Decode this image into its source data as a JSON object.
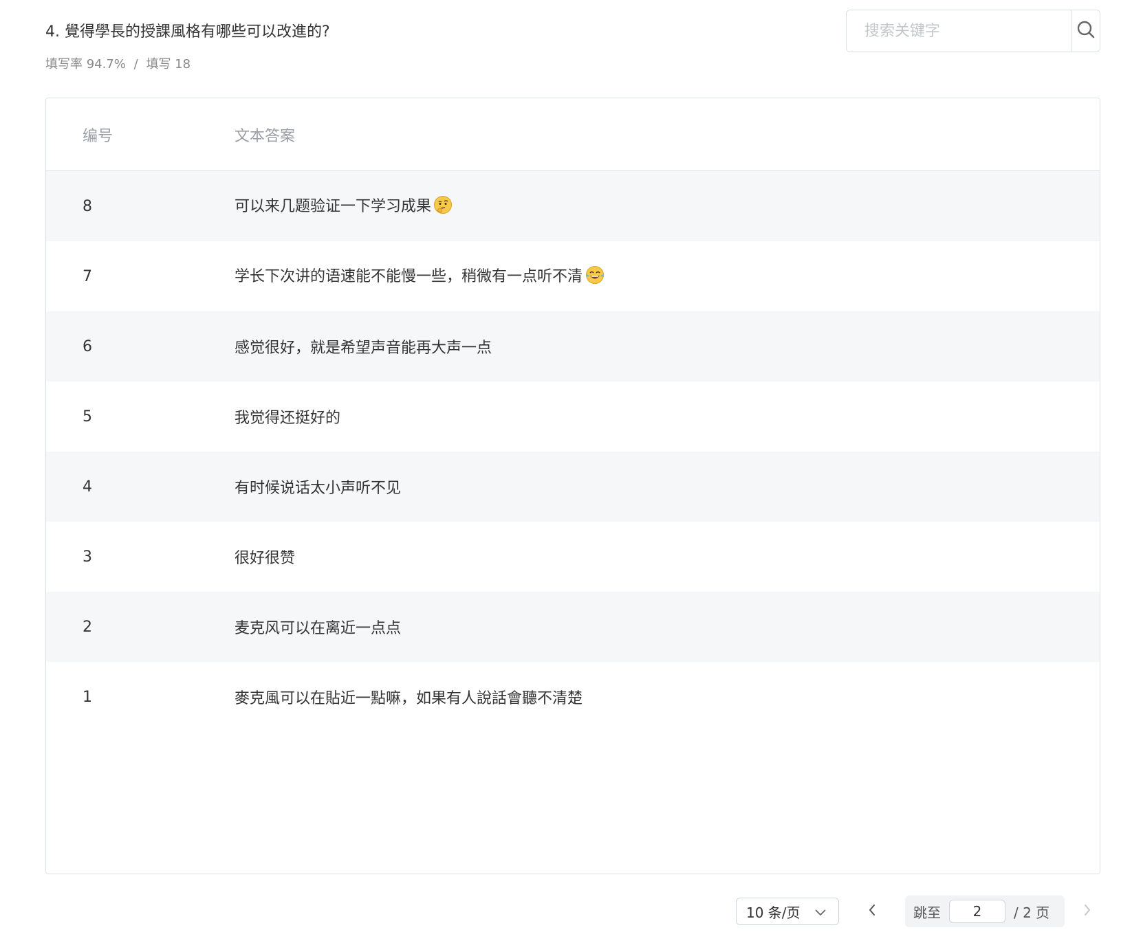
{
  "question": {
    "title": "4. 覺得學長的授課風格有哪些可以改進的?",
    "fill_rate_label": "填写率 94.7%",
    "separator": "/",
    "fill_count_label": "填写 18"
  },
  "search": {
    "placeholder": "搜索关键字",
    "icon": "search-icon"
  },
  "table": {
    "headers": {
      "id": "编号",
      "text": "文本答案"
    },
    "rows": [
      {
        "id": "8",
        "text": "可以来几题验证一下学习成果",
        "emoji": "thinking-face-icon"
      },
      {
        "id": "7",
        "text": "学长下次讲的语速能不能慢一些，稍微有一点听不清",
        "emoji": "tears-of-joy-icon"
      },
      {
        "id": "6",
        "text": "感觉很好，就是希望声音能再大声一点"
      },
      {
        "id": "5",
        "text": "我觉得还挺好的"
      },
      {
        "id": "4",
        "text": "有时候说话太小声听不见"
      },
      {
        "id": "3",
        "text": "很好很赞"
      },
      {
        "id": "2",
        "text": "麦克风可以在离近一点点"
      },
      {
        "id": "1",
        "text": "麥克風可以在貼近一點嘛，如果有人說話會聽不清楚"
      }
    ],
    "stripe_color": "#f6f7f9",
    "border_color": "#d9e1ec"
  },
  "pagination": {
    "page_size_label": "10 条/页",
    "jump_label": "跳至",
    "current_page": "2",
    "total_label": "/ 2 页",
    "prev_icon": "chevron-left-icon",
    "next_icon": "chevron-right-icon",
    "dropdown_icon": "chevron-down-icon"
  }
}
